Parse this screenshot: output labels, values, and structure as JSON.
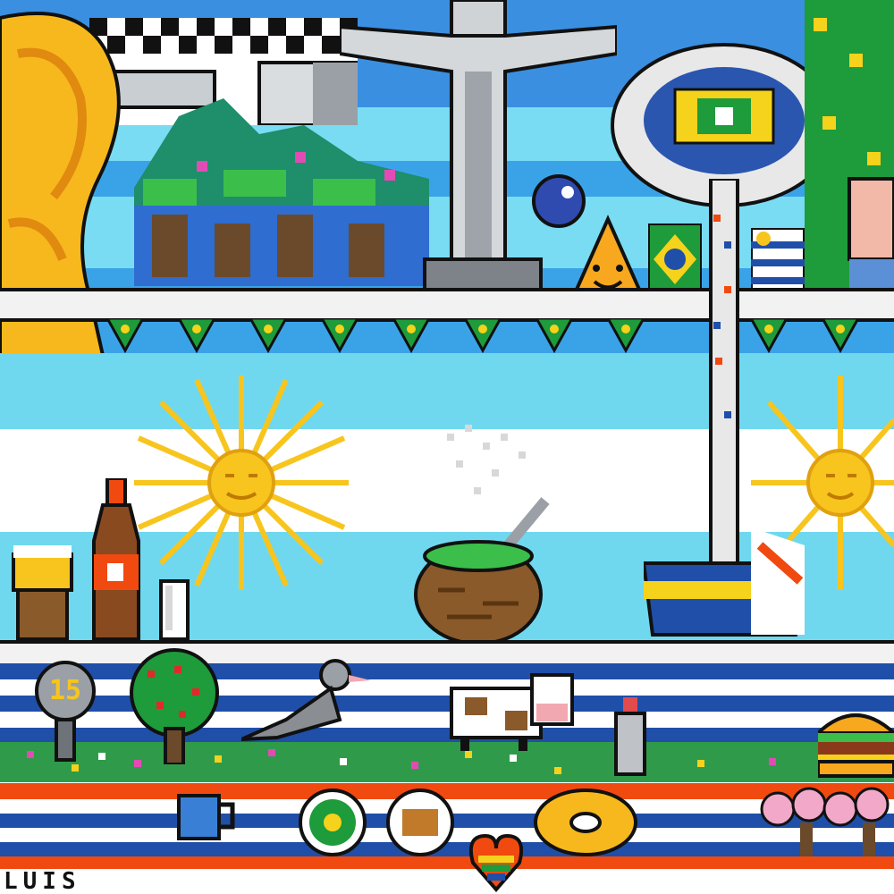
{
  "artwork": {
    "badge_number": "15",
    "bottom_text": "LUIS"
  },
  "palette": {
    "sky_blue": "#6fd8ef",
    "flag_white": "#ffffff",
    "sun_yellow": "#f7c51e",
    "brazil_green": "#1e9b3a",
    "brazil_yellow": "#f5d21b",
    "uruguay_blue": "#1f4fa8",
    "orange_red": "#f04a10",
    "outline": "#111111"
  },
  "icons": [
    "world-cup-trophy-icon",
    "christ-the-redeemer-icon",
    "stadium-icon",
    "brazil-flag-icon",
    "uruguay-flag-icon",
    "argentina-sun-icon",
    "mate-gourd-icon",
    "soda-bottle-icon",
    "number-badge-icon",
    "tree-icon",
    "bird-icon",
    "cow-icon",
    "heart-icon",
    "donut-icon",
    "burger-icon"
  ]
}
